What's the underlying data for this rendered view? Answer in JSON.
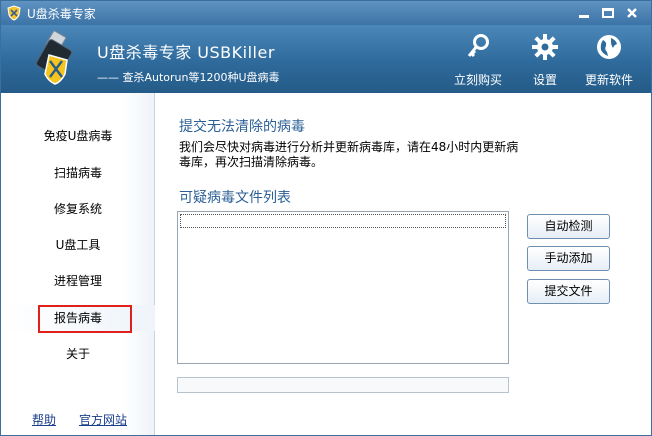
{
  "window": {
    "title": "U盘杀毒专家"
  },
  "header": {
    "product_name": "U盘杀毒专家   USBKiller",
    "subtitle": "—— 查杀Autorun等1200种U盘病毒",
    "buttons": {
      "buy": "立刻购买",
      "settings": "设置",
      "update": "更新软件"
    }
  },
  "sidebar": {
    "items": [
      {
        "label": "免疫U盘病毒"
      },
      {
        "label": "扫描病毒"
      },
      {
        "label": "修复系统"
      },
      {
        "label": "U盘工具"
      },
      {
        "label": "进程管理"
      },
      {
        "label": "报告病毒"
      },
      {
        "label": "关于"
      }
    ],
    "active_index": 5,
    "links": {
      "help": "帮助",
      "website": "官方网站"
    }
  },
  "main": {
    "section_title": "提交无法清除的病毒",
    "description": "我们会尽快对病毒进行分析并更新病毒库，请在48小时内更新病毒库，再次扫描清除病毒。",
    "list_title": "可疑病毒文件列表",
    "progress": 0,
    "buttons": {
      "auto_detect": "自动检测",
      "manual_add": "手动添加",
      "submit_file": "提交文件"
    }
  },
  "colors": {
    "titlebar": "#3c73a6",
    "header": "#2e6a9b",
    "accent_text": "#2b5f95",
    "highlight_border": "#e0201c",
    "link": "#1a3e8c"
  },
  "icons": {
    "app": "shield-icon",
    "logo": "usb-shield-icon",
    "buy": "key-icon",
    "settings": "gear-icon",
    "update": "globe-icon"
  }
}
